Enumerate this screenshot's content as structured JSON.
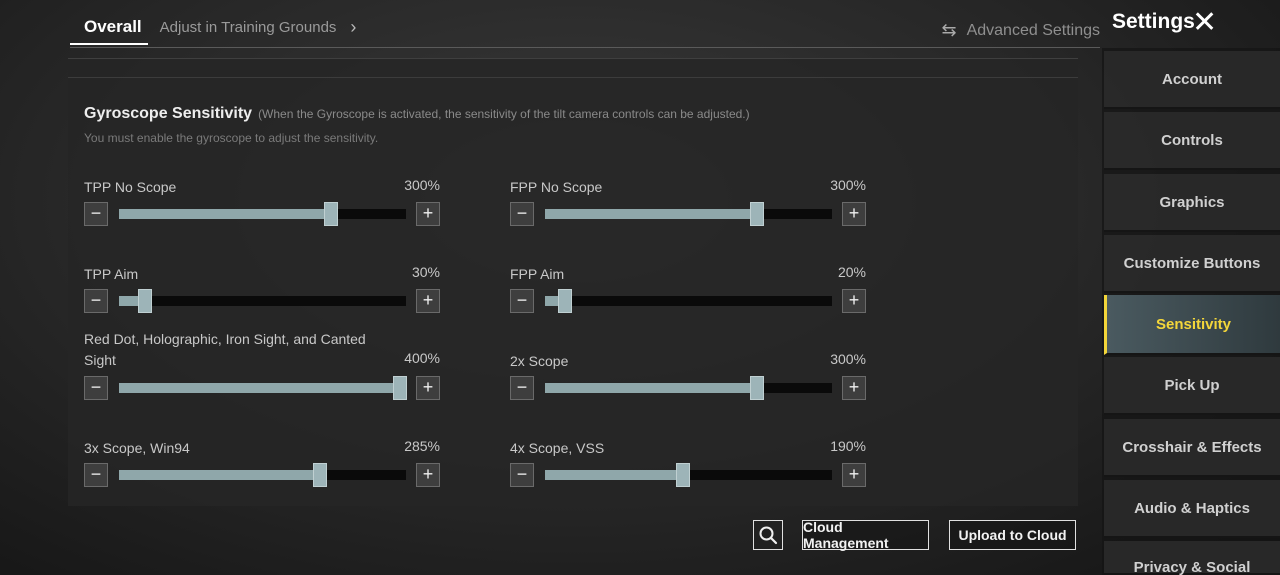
{
  "header": {
    "tab_overall": "Overall",
    "tab_adjust": "Adjust in Training Grounds",
    "chevron": "›",
    "advanced_icon": "⇆",
    "advanced_label": "Advanced Settings"
  },
  "gyro": {
    "title": "Gyroscope Sensitivity",
    "note": "(When the Gyroscope is activated, the sensitivity of the tilt camera controls can be adjusted.)",
    "subtitle": "You must enable the gyroscope to adjust the sensitivity."
  },
  "sliders": [
    {
      "label": "TPP No Scope",
      "value": "300%",
      "level": 0.74
    },
    {
      "label": "FPP No Scope",
      "value": "300%",
      "level": 0.74
    },
    {
      "label": "TPP Aim",
      "value": "30%",
      "level": 0.09
    },
    {
      "label": "FPP Aim",
      "value": "20%",
      "level": 0.07
    },
    {
      "label": "Red Dot, Holographic, Iron Sight, and Canted Sight",
      "value": "400%",
      "level": 0.98
    },
    {
      "label": "2x Scope",
      "value": "300%",
      "level": 0.74
    },
    {
      "label": "3x Scope, Win94",
      "value": "285%",
      "level": 0.7
    },
    {
      "label": "4x Scope, VSS",
      "value": "190%",
      "level": 0.48
    }
  ],
  "controls": {
    "minus": "−",
    "plus": "+"
  },
  "sidebar": {
    "title": "Settings",
    "close": "✕",
    "items": [
      {
        "label": "Account"
      },
      {
        "label": "Controls"
      },
      {
        "label": "Graphics"
      },
      {
        "label": "Customize Buttons"
      },
      {
        "label": "Sensitivity"
      },
      {
        "label": "Pick Up"
      },
      {
        "label": "Crosshair & Effects"
      },
      {
        "label": "Audio & Haptics"
      },
      {
        "label": "Privacy & Social"
      }
    ]
  },
  "bottom": {
    "search_icon": "search-icon",
    "cloud_management": "Cloud Management",
    "upload": "Upload to Cloud"
  },
  "colors": {
    "accent": "#f3d63a",
    "slider_fill": "#8fa7aa"
  }
}
